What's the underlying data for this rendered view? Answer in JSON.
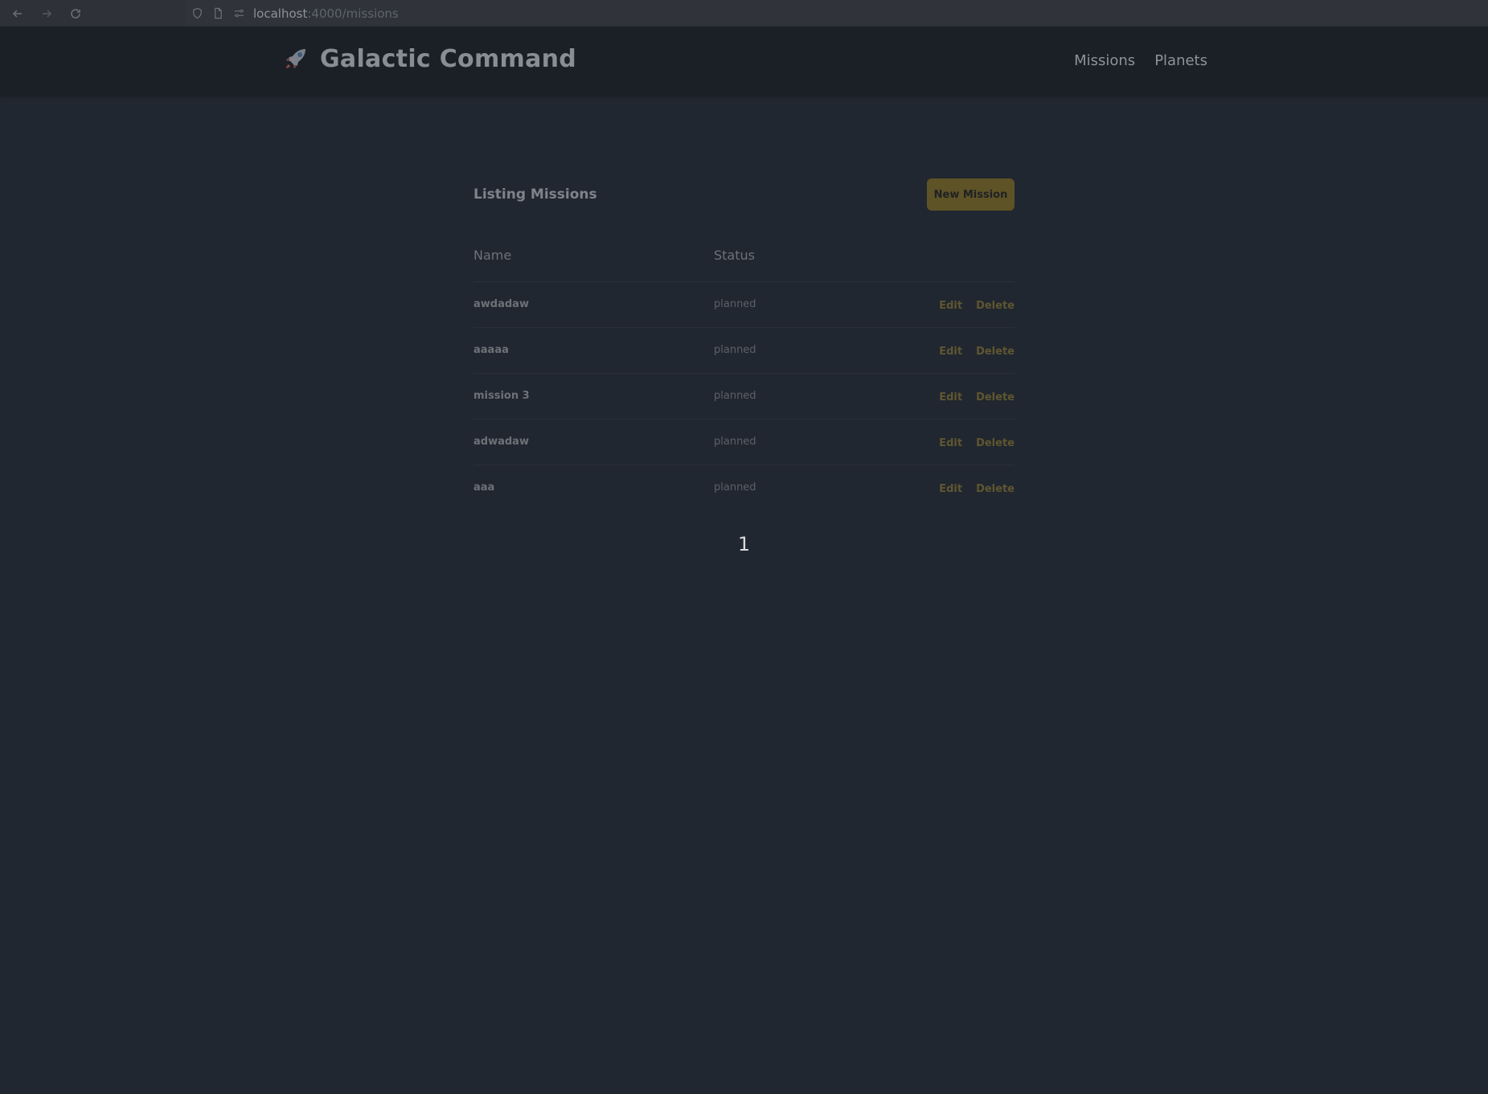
{
  "browser": {
    "url_host": "localhost",
    "url_path": ":4000/missions"
  },
  "header": {
    "title": "Galactic Command",
    "nav": [
      {
        "label": "Missions"
      },
      {
        "label": "Planets"
      }
    ]
  },
  "main": {
    "title": "Listing Missions",
    "new_button": "New Mission",
    "columns": {
      "name": "Name",
      "status": "Status"
    },
    "rows": [
      {
        "name": "awdadaw",
        "status": "planned",
        "edit": "Edit",
        "delete": "Delete"
      },
      {
        "name": "aaaaa",
        "status": "planned",
        "edit": "Edit",
        "delete": "Delete"
      },
      {
        "name": "mission 3",
        "status": "planned",
        "edit": "Edit",
        "delete": "Delete"
      },
      {
        "name": "adwadaw",
        "status": "planned",
        "edit": "Edit",
        "delete": "Delete"
      },
      {
        "name": "aaa",
        "status": "planned",
        "edit": "Edit",
        "delete": "Delete"
      }
    ],
    "pagination": {
      "current_page": "1"
    }
  },
  "colors": {
    "background": "#212730",
    "header_bg": "#1b1f26",
    "accent": "#5e5326",
    "action_link": "#5f5630"
  },
  "icons": [
    "back-arrow-icon",
    "forward-arrow-icon",
    "reload-icon",
    "shield-icon",
    "page-icon",
    "site-settings-icon",
    "rocket-icon"
  ]
}
